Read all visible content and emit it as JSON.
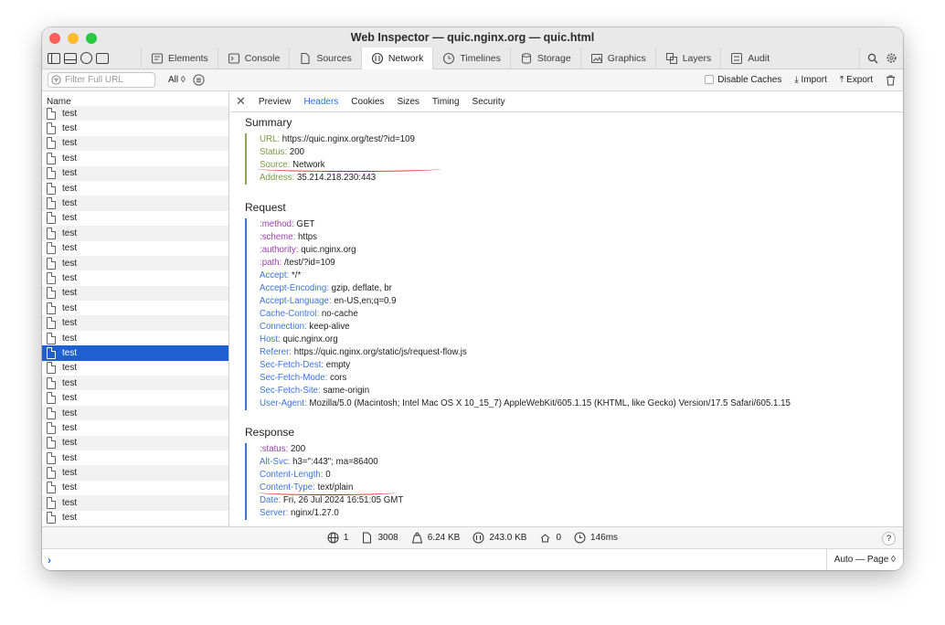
{
  "window": {
    "title": "Web Inspector — quic.nginx.org — quic.html"
  },
  "colors": {
    "selection": "#1e5fd1",
    "accent": "#1f6fe0",
    "underline": "#d82020",
    "request_key": "#3d74d6",
    "summary_key": "#7b9a44",
    "pseudo_key": "#9b3fb0"
  },
  "tabs": [
    {
      "label": "Elements",
      "icon": "elements-icon"
    },
    {
      "label": "Console",
      "icon": "console-icon"
    },
    {
      "label": "Sources",
      "icon": "sources-icon"
    },
    {
      "label": "Network",
      "icon": "network-icon",
      "active": true
    },
    {
      "label": "Timelines",
      "icon": "timelines-icon"
    },
    {
      "label": "Storage",
      "icon": "storage-icon"
    },
    {
      "label": "Graphics",
      "icon": "graphics-icon"
    },
    {
      "label": "Layers",
      "icon": "layers-icon"
    },
    {
      "label": "Audit",
      "icon": "audit-icon"
    }
  ],
  "filterbar": {
    "filter_placeholder": "Filter Full URL",
    "type_filter": "All",
    "disable_caches": "Disable Caches",
    "import": "Import",
    "export": "Export"
  },
  "list": {
    "header": "Name",
    "items": [
      "test",
      "test",
      "test",
      "test",
      "test",
      "test",
      "test",
      "test",
      "test",
      "test",
      "test",
      "test",
      "test",
      "test",
      "test",
      "test",
      "test",
      "test",
      "test",
      "test",
      "test",
      "test",
      "test",
      "test",
      "test",
      "test",
      "test",
      "test",
      "test"
    ],
    "selected_index": 16
  },
  "detail_tabs": [
    "Preview",
    "Headers",
    "Cookies",
    "Sizes",
    "Timing",
    "Security"
  ],
  "active_detail_tab": "Headers",
  "summary": {
    "title": "Summary",
    "fields": [
      {
        "key": "URL:",
        "value": "https://quic.nginx.org/test/?id=109"
      },
      {
        "key": "Status:",
        "value": "200"
      },
      {
        "key": "Source:",
        "value": "Network"
      },
      {
        "key": "Address:",
        "value": "35.214.218.230:443"
      }
    ]
  },
  "request": {
    "title": "Request",
    "headers": [
      {
        "key": ":method:",
        "value": "GET"
      },
      {
        "key": ":scheme:",
        "value": "https"
      },
      {
        "key": ":authority:",
        "value": "quic.nginx.org"
      },
      {
        "key": ":path:",
        "value": "/test/?id=109"
      },
      {
        "key": "Accept:",
        "value": "*/*"
      },
      {
        "key": "Accept-Encoding:",
        "value": "gzip, deflate, br"
      },
      {
        "key": "Accept-Language:",
        "value": "en-US,en;q=0.9"
      },
      {
        "key": "Cache-Control:",
        "value": "no-cache"
      },
      {
        "key": "Connection:",
        "value": "keep-alive"
      },
      {
        "key": "Host:",
        "value": "quic.nginx.org"
      },
      {
        "key": "Referer:",
        "value": "https://quic.nginx.org/static/js/request-flow.js"
      },
      {
        "key": "Sec-Fetch-Dest:",
        "value": "empty"
      },
      {
        "key": "Sec-Fetch-Mode:",
        "value": "cors"
      },
      {
        "key": "Sec-Fetch-Site:",
        "value": "same-origin"
      },
      {
        "key": "User-Agent:",
        "value": "Mozilla/5.0 (Macintosh; Intel Mac OS X 10_15_7) AppleWebKit/605.1.15 (KHTML, like Gecko) Version/17.5 Safari/605.1.15"
      }
    ]
  },
  "response": {
    "title": "Response",
    "headers": [
      {
        "key": ":status:",
        "value": "200"
      },
      {
        "key": "Alt-Svc:",
        "value": "h3=\":443\"; ma=86400"
      },
      {
        "key": "Content-Length:",
        "value": "0"
      },
      {
        "key": "Content-Type:",
        "value": "text/plain"
      },
      {
        "key": "Date:",
        "value": "Fri, 26 Jul 2024 16:51:05 GMT"
      },
      {
        "key": "Server:",
        "value": "nginx/1.27.0"
      }
    ]
  },
  "statusbar": {
    "domains": "1",
    "requests": "3008",
    "transferred": "6.24 KB",
    "resources": "243.0 KB",
    "redirects": "0",
    "time": "146ms",
    "help": "?"
  },
  "console": {
    "prompt": "›",
    "context": "Auto — Page ◊"
  }
}
